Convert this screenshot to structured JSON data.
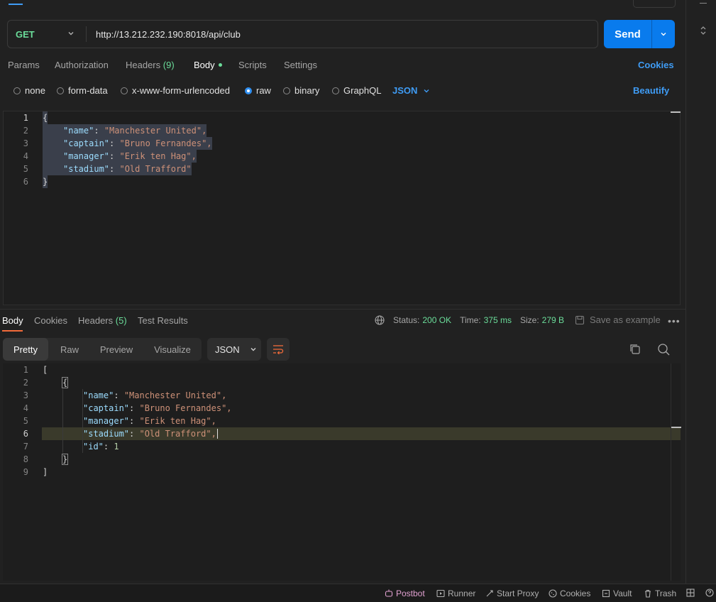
{
  "request": {
    "method": "GET",
    "url": "http://13.212.232.190:8018/api/club",
    "send_label": "Send"
  },
  "request_tabs": [
    {
      "label": "Params"
    },
    {
      "label": "Authorization"
    },
    {
      "label": "Headers",
      "count": "(9)"
    },
    {
      "label": "Body"
    },
    {
      "label": "Scripts"
    },
    {
      "label": "Settings"
    }
  ],
  "cookies_label": "Cookies",
  "body_types": [
    "none",
    "form-data",
    "x-www-form-urlencoded",
    "raw",
    "binary",
    "GraphQL"
  ],
  "body_language": "JSON",
  "beautify_label": "Beautify",
  "request_body": {
    "lines": [
      "1",
      "2",
      "3",
      "4",
      "5",
      "6"
    ],
    "open": "{",
    "close": "}",
    "fields": [
      {
        "key": "\"name\"",
        "value": "\"Manchester United\","
      },
      {
        "key": "\"captain\"",
        "value": "\"Bruno Fernandes\","
      },
      {
        "key": "\"manager\"",
        "value": "\"Erik ten Hag\","
      },
      {
        "key": "\"stadium\"",
        "value": "\"Old Trafford\""
      }
    ]
  },
  "response_tabs": [
    {
      "label": "Body"
    },
    {
      "label": "Cookies"
    },
    {
      "label": "Headers",
      "count": "(5)"
    },
    {
      "label": "Test Results"
    }
  ],
  "response_meta": {
    "status_label": "Status:",
    "status_value": "200 OK",
    "time_label": "Time:",
    "time_value": "375 ms",
    "size_label": "Size:",
    "size_value": "279 B",
    "save_label": "Save as example"
  },
  "view_modes": [
    "Pretty",
    "Raw",
    "Preview",
    "Visualize"
  ],
  "response_format": "JSON",
  "response_body": {
    "lines": [
      "1",
      "2",
      "3",
      "4",
      "5",
      "6",
      "7",
      "8",
      "9"
    ],
    "l1": "[",
    "l2": "{",
    "fields": [
      {
        "key": "\"name\"",
        "value": "\"Manchester United\","
      },
      {
        "key": "\"captain\"",
        "value": "\"Bruno Fernandes\","
      },
      {
        "key": "\"manager\"",
        "value": "\"Erik ten Hag\","
      },
      {
        "key": "\"stadium\"",
        "value": "\"Old Trafford\","
      },
      {
        "key": "\"id\"",
        "value": "1"
      }
    ],
    "l8": "}",
    "l9": "]"
  },
  "statusbar": {
    "postbot": "Postbot",
    "runner": "Runner",
    "proxy": "Start Proxy",
    "cookies": "Cookies",
    "vault": "Vault",
    "trash": "Trash"
  },
  "colors": {
    "accent": "#097bed",
    "link": "#3f9cf5",
    "method_get": "#6bdd9a",
    "json_key": "#9cdcfe",
    "json_string": "#ce9178",
    "active_underline": "#f26b3a"
  }
}
